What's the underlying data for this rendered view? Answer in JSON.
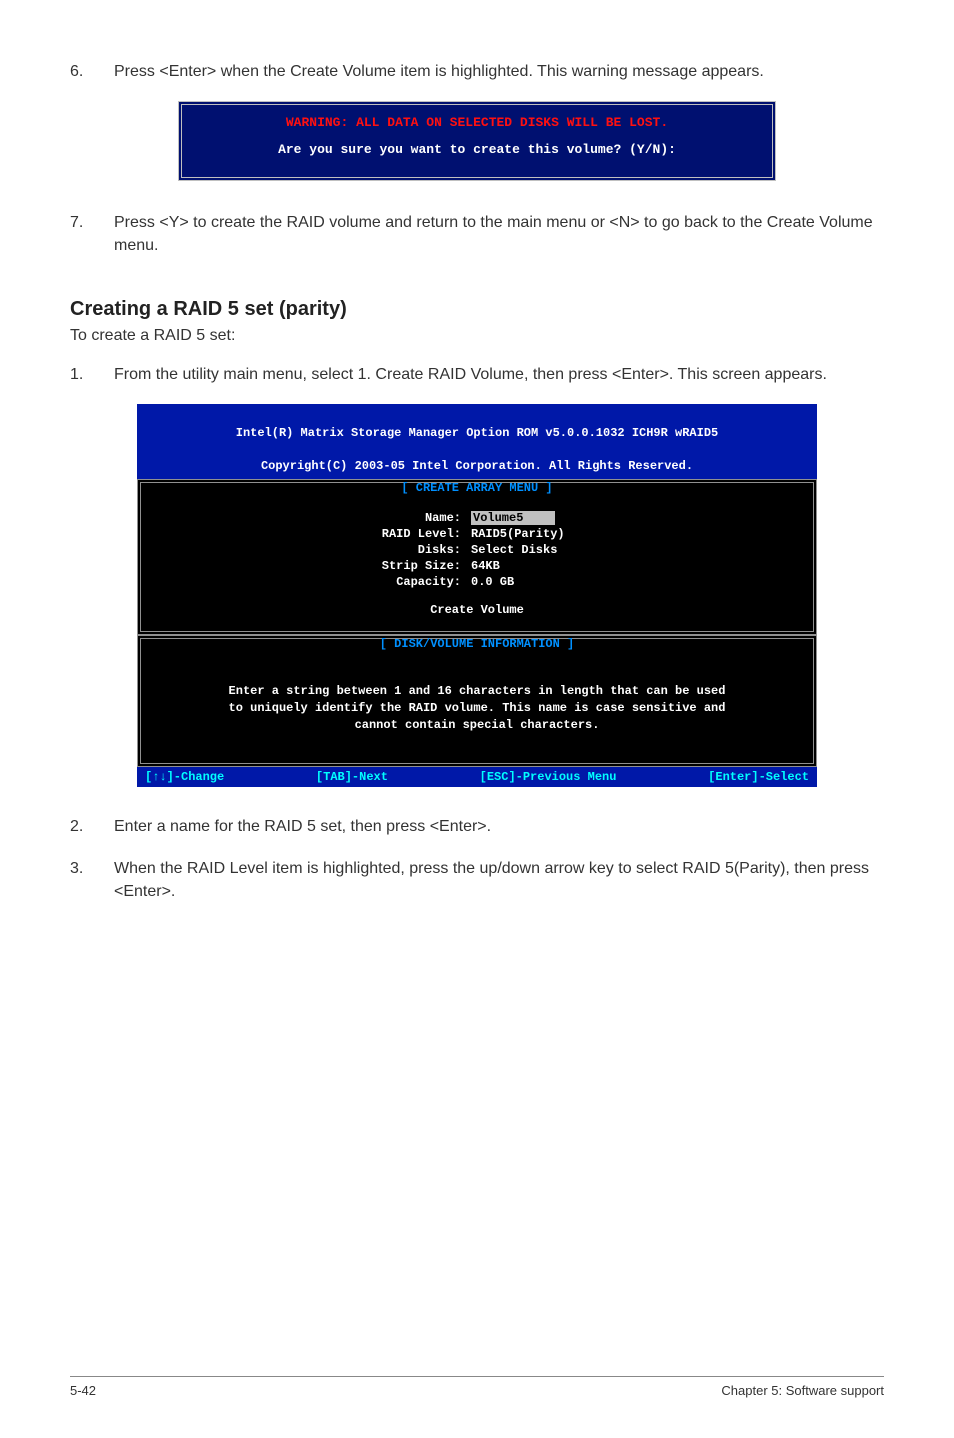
{
  "step6": {
    "num": "6.",
    "text": "Press <Enter> when the Create Volume item is highlighted. This warning message appears."
  },
  "box1": {
    "warning": "WARNING: ALL DATA ON SELECTED DISKS WILL BE LOST.",
    "question": "Are you sure you want to create this volume? (Y/N):"
  },
  "step7": {
    "num": "7.",
    "text": "Press <Y> to create the RAID volume and return to the main menu or <N> to go back to the Create Volume menu."
  },
  "section_heading": "Creating a RAID 5 set (parity)",
  "intro": "To create a RAID 5 set:",
  "step1": {
    "num": "1.",
    "text": "From the utility main menu, select 1. Create RAID Volume, then press <Enter>. This screen appears."
  },
  "bios": {
    "title_l1": "Intel(R) Matrix Storage Manager Option ROM v5.0.0.1032 ICH9R wRAID5",
    "title_l2": "Copyright(C) 2003-05 Intel Corporation. All Rights Reserved.",
    "panel1_head": "[ CREATE ARRAY MENU ]",
    "fields": {
      "name_lbl": "Name:",
      "name_val": "Volume5",
      "raid_lbl": "RAID Level:",
      "raid_val": "RAID5(Parity)",
      "disks_lbl": "Disks:",
      "disks_val": "Select Disks",
      "strip_lbl": "Strip Size:",
      "strip_val": "64KB",
      "cap_lbl": "Capacity:",
      "cap_val": "0.0  GB"
    },
    "create_btn": "Create Volume",
    "panel2_head": "[ DISK/VOLUME INFORMATION ]",
    "info_l1": "Enter a string between 1 and 16 characters in length that can be used",
    "info_l2": "to uniquely identify the RAID volume. This name is case sensitive and",
    "info_l3": "cannot contain special characters.",
    "footer": {
      "change": "[↑↓]-Change",
      "next": "[TAB]-Next",
      "prev": "[ESC]-Previous Menu",
      "select": "[Enter]-Select"
    }
  },
  "step2": {
    "num": "2.",
    "text": "Enter a name for the RAID 5 set, then press <Enter>."
  },
  "step3": {
    "num": "3.",
    "text": "When the RAID Level item is highlighted, press the up/down arrow key to select RAID 5(Parity), then press <Enter>."
  },
  "footer": {
    "left": "5-42",
    "right": "Chapter 5: Software support"
  }
}
